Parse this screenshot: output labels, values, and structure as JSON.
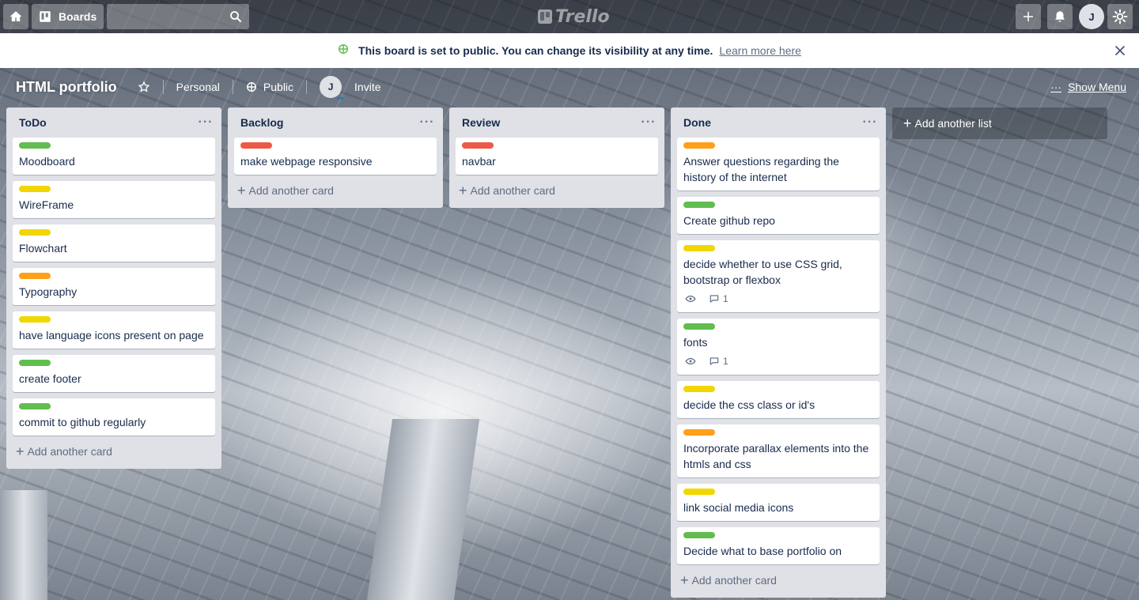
{
  "header": {
    "boards_label": "Boards",
    "logo_text": "Trello",
    "avatar_initial": "J"
  },
  "banner": {
    "message": "This board is set to public. You can change its visibility at any time.",
    "learn_more": "Learn more here"
  },
  "board": {
    "title": "HTML portfolio",
    "team": "Personal",
    "visibility": "Public",
    "member_initial": "J",
    "invite": "Invite",
    "show_menu": "Show Menu"
  },
  "colors": {
    "green": "#61bd4f",
    "yellow": "#f2d600",
    "orange": "#ff9f1a",
    "red": "#eb5a46"
  },
  "lists": [
    {
      "title": "ToDo",
      "cards": [
        {
          "text": "Moodboard",
          "label": "green"
        },
        {
          "text": "WireFrame",
          "label": "yellow"
        },
        {
          "text": "Flowchart",
          "label": "yellow"
        },
        {
          "text": "Typography",
          "label": "orange"
        },
        {
          "text": "have language icons present on page",
          "label": "yellow"
        },
        {
          "text": "create footer",
          "label": "green"
        },
        {
          "text": "commit to github regularly",
          "label": "green"
        }
      ],
      "add_card": "Add another card"
    },
    {
      "title": "Backlog",
      "cards": [
        {
          "text": "make webpage responsive",
          "label": "red"
        }
      ],
      "add_card": "Add another card"
    },
    {
      "title": "Review",
      "cards": [
        {
          "text": "navbar",
          "label": "red"
        }
      ],
      "add_card": "Add another card"
    },
    {
      "title": "Done",
      "cards": [
        {
          "text": "Answer questions regarding the history of the internet",
          "label": "orange"
        },
        {
          "text": "Create github repo",
          "label": "green"
        },
        {
          "text": "decide whether to use CSS grid, bootstrap or flexbox",
          "label": "yellow",
          "comments": "1"
        },
        {
          "text": "fonts",
          "label": "green",
          "comments": "1"
        },
        {
          "text": "decide the css class or id's",
          "label": "yellow"
        },
        {
          "text": "Incorporate parallax elements into the htmls and css",
          "label": "orange"
        },
        {
          "text": "link social media icons",
          "label": "yellow"
        },
        {
          "text": "Decide what to base portfolio on",
          "label": "green"
        }
      ],
      "add_card": "Add another card"
    }
  ],
  "add_list": "Add another list"
}
